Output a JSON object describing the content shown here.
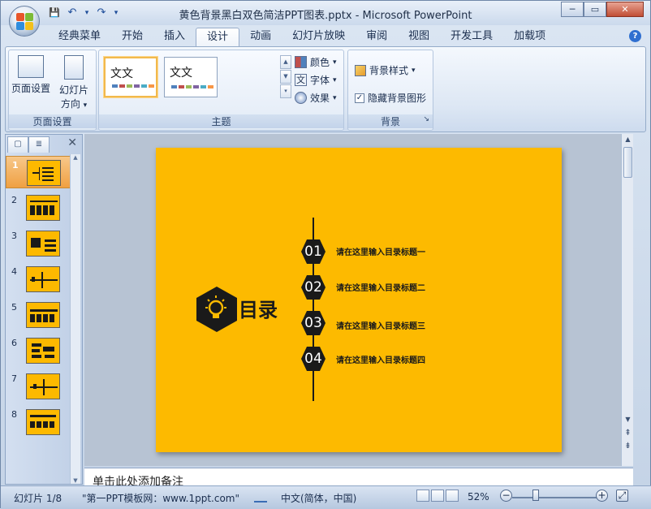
{
  "window": {
    "title": "黄色背景黑白双色简洁PPT图表.pptx - Microsoft PowerPoint",
    "controls": {
      "minimize": "─",
      "maximize": "▭",
      "close": "✕"
    }
  },
  "qat": {
    "save": "💾",
    "undo": "↶",
    "redo": "↷",
    "more": "▾"
  },
  "ribbon": {
    "tabs": [
      "经典菜单",
      "开始",
      "插入",
      "设计",
      "动画",
      "幻灯片放映",
      "审阅",
      "视图",
      "开发工具",
      "加载项"
    ],
    "active_tab": "设计",
    "help": "?",
    "page_setup": {
      "page_setup_label": "页面设置",
      "orientation_label": "幻灯片",
      "orientation_sub": "方向",
      "orientation_arrow": "▾",
      "group_label": "页面设置"
    },
    "themes": {
      "items": [
        {
          "text": "文文",
          "colors": [
            "#4f81bd",
            "#c0504d",
            "#9bbb59",
            "#8064a2",
            "#4bacc6",
            "#f79646"
          ]
        },
        {
          "text": "文文",
          "colors": [
            "#4f81bd",
            "#c0504d",
            "#9bbb59",
            "#8064a2",
            "#4bacc6",
            "#f79646"
          ]
        }
      ],
      "colors_label": "颜色",
      "fonts_label": "字体",
      "effects_label": "效果",
      "fonts_icon": "文",
      "group_label": "主题",
      "scroll": [
        "▲",
        "▼",
        "▾"
      ]
    },
    "background": {
      "styles_label": "背景样式",
      "hide_label": "隐藏背景图形",
      "hide_checked": true,
      "check_mark": "✓",
      "group_label": "背景",
      "launcher": "↘"
    }
  },
  "slides_pane": {
    "close": "✕",
    "tab_slides": "▢",
    "tab_outline": "≣",
    "thumbnails": [
      {
        "number": "1",
        "selected": true
      },
      {
        "number": "2",
        "selected": false
      },
      {
        "number": "3",
        "selected": false
      },
      {
        "number": "4",
        "selected": false
      },
      {
        "number": "5",
        "selected": false
      },
      {
        "number": "6",
        "selected": false
      },
      {
        "number": "7",
        "selected": false
      },
      {
        "number": "8",
        "selected": false
      }
    ],
    "scroll_up": "▲",
    "scroll_down": "▼"
  },
  "slide": {
    "background": "#fdba00",
    "title": "目录",
    "items": [
      {
        "num": "01",
        "text": "请在这里输入目录标题一"
      },
      {
        "num": "02",
        "text": "请在这里输入目录标题二"
      },
      {
        "num": "03",
        "text": "请在这里输入目录标题三"
      },
      {
        "num": "04",
        "text": "请在这里输入目录标题四"
      }
    ]
  },
  "main_scroll": {
    "up": "▲",
    "down": "▼",
    "prev": "⇞",
    "next": "⇟"
  },
  "notes": {
    "placeholder": "单击此处添加备注"
  },
  "statusbar": {
    "slide_indicator": "幻灯片 1/8",
    "theme_name": "\"第一PPT模板网：www.1ppt.com\"",
    "language": "中文(简体，中国)",
    "zoom": "52%",
    "zoom_out": "−",
    "zoom_in": "+",
    "fit": "⤢"
  }
}
